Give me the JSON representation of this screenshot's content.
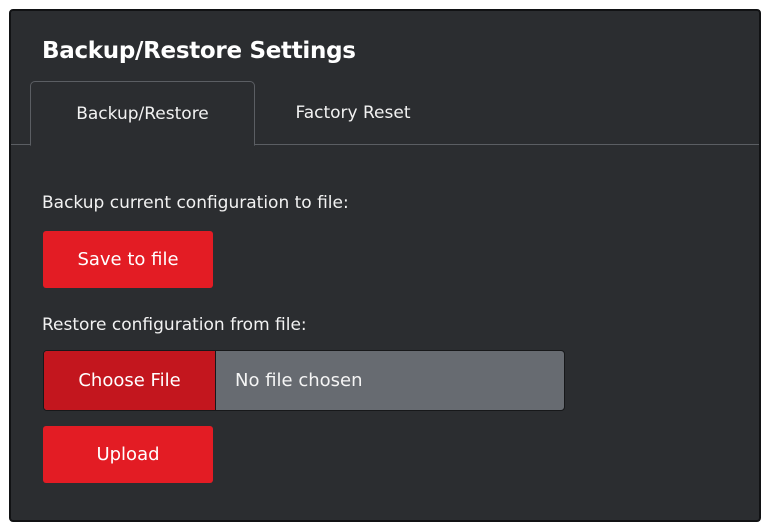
{
  "panel": {
    "title": "Backup/Restore Settings"
  },
  "tabs": [
    {
      "label": "Backup/Restore",
      "active": true
    },
    {
      "label": "Factory Reset",
      "active": false
    }
  ],
  "backup": {
    "label": "Backup current configuration to file:",
    "save_button": "Save to file"
  },
  "restore": {
    "label": "Restore configuration from file:",
    "choose_button": "Choose File",
    "file_status": "No file chosen",
    "upload_button": "Upload"
  },
  "colors": {
    "panel_background": "#2b2d30",
    "accent_red": "#e31c24",
    "file_button_red": "#c3161e",
    "file_field_gray": "#676b71"
  }
}
